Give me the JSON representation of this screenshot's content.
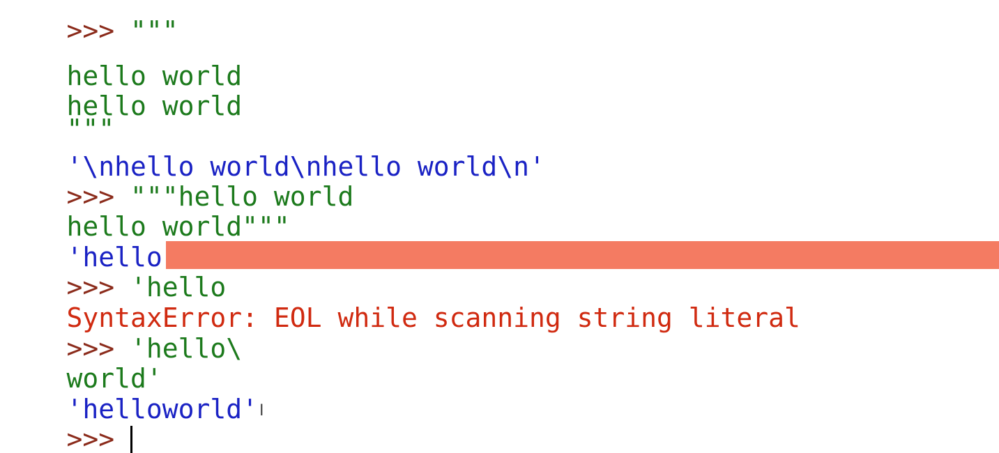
{
  "shell": {
    "prompt": ">>> ",
    "lines": [
      {
        "kind": "prompt-input",
        "prompt": ">>> ",
        "text": "\"\"\""
      },
      {
        "kind": "input",
        "text": "hello world"
      },
      {
        "kind": "input",
        "text": "hello world"
      },
      {
        "kind": "input",
        "text": "\"\"\""
      },
      {
        "kind": "output",
        "text": "'\\nhello world\\nhello world\\n'"
      },
      {
        "kind": "prompt-input",
        "prompt": ">>> ",
        "text": "\"\"\"hello world"
      },
      {
        "kind": "input",
        "text": "hello world\"\"\""
      },
      {
        "kind": "output",
        "text": "'hello world\\nhello world'"
      },
      {
        "kind": "prompt-input",
        "prompt": ">>> ",
        "text": "'hello"
      },
      {
        "kind": "error",
        "text": "SyntaxError: EOL while scanning string literal"
      },
      {
        "kind": "prompt-input",
        "prompt": ">>> ",
        "text": "'hello\\"
      },
      {
        "kind": "input",
        "text": "world'"
      },
      {
        "kind": "output",
        "text": "'helloworld'"
      },
      {
        "kind": "prompt-input",
        "prompt": ">>> ",
        "text": ""
      }
    ]
  },
  "colors": {
    "prompt": "#8b2b1b",
    "input": "#1c7a1c",
    "output": "#1a22c4",
    "error": "#d02a10",
    "error_highlight": "#f47b62"
  },
  "cursor": {
    "icon": "text-cursor-ibeam-icon",
    "glyph": "I"
  }
}
